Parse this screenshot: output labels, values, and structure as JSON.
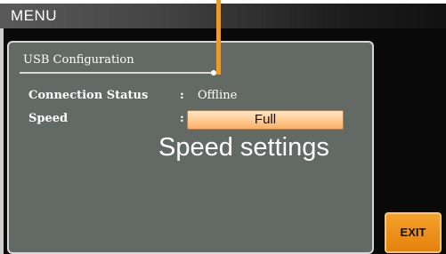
{
  "menu": {
    "title": "MENU"
  },
  "panel": {
    "title": "USB Configuration",
    "fields": [
      {
        "label": "Connection Status",
        "colon": ":",
        "value": "Offline"
      },
      {
        "label": "Speed",
        "colon": ":",
        "value": "Full"
      }
    ]
  },
  "annotation": {
    "text": "Speed settings"
  },
  "softkeys": {
    "exit_label": "EXIT"
  },
  "colors": {
    "panel_background": "#636a66",
    "selection_highlight": "#ffc98f",
    "callout_orange": "#f39a1e",
    "exit_button": "#e4820c"
  }
}
